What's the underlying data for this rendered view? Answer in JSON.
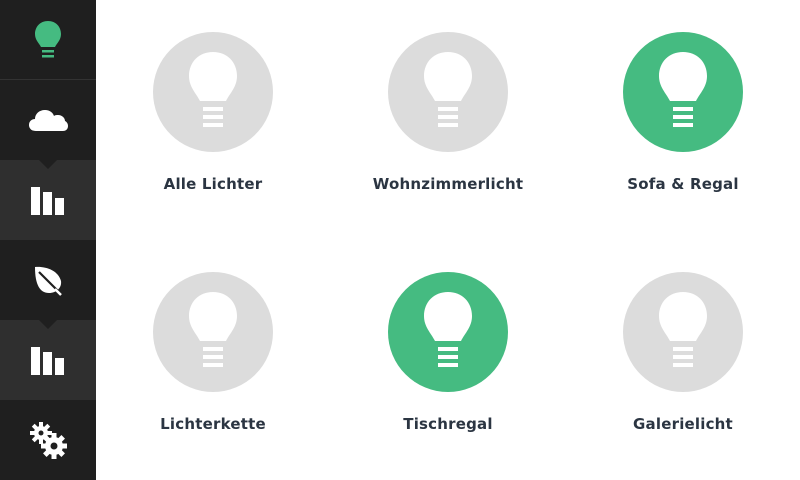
{
  "sidebar": {
    "items": [
      {
        "icon": "bulb-icon",
        "active": true
      },
      {
        "icon": "cloud-icon"
      },
      {
        "icon": "bar-chart-icon"
      },
      {
        "icon": "leaf-icon"
      },
      {
        "icon": "bar-chart-icon"
      },
      {
        "icon": "gears-icon"
      }
    ],
    "active_color": "#45bb81",
    "icon_color": "#ffffff"
  },
  "lights": [
    {
      "label": "Alle Lichter",
      "on": false
    },
    {
      "label": "Wohnzimmerlicht",
      "on": false
    },
    {
      "label": "Sofa & Regal",
      "on": true
    },
    {
      "label": "Lichterkette",
      "on": false
    },
    {
      "label": "Tischregal",
      "on": true
    },
    {
      "label": "Galerielicht",
      "on": false
    }
  ],
  "colors": {
    "on": "#45bb81",
    "off": "#dcdcdc",
    "label": "#2b3542",
    "sidebar_bg": "#1f1f1f",
    "sidebar_sub_bg": "#2f2f2f"
  }
}
